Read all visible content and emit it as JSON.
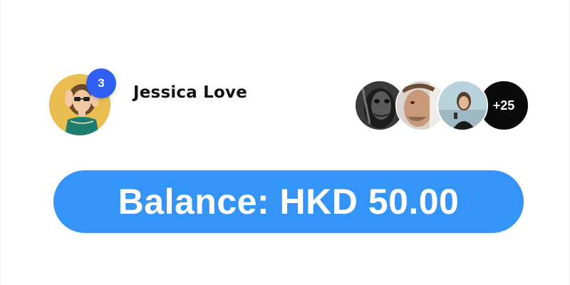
{
  "profile": {
    "name": "Jessica Love",
    "notification_count": "3"
  },
  "avatar_group": {
    "overflow_label": "+25"
  },
  "balance": {
    "text": "Balance: HKD 50.00"
  },
  "colors": {
    "badge": "#2f5ff5",
    "balance_bg": "#3494f7",
    "overflow_bg": "#0a0a0a"
  }
}
